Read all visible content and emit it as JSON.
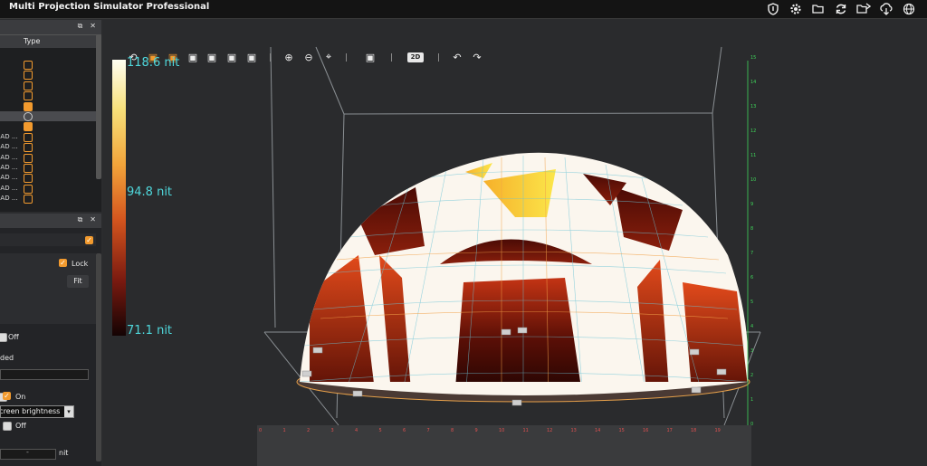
{
  "app": {
    "title": "Multi Projection Simulator Professional"
  },
  "titlebar_icons": [
    "shield-icon",
    "gear-icon",
    "folder-open-icon",
    "refresh-icon",
    "folder-load-icon",
    "cloud-download-icon",
    "globe-icon"
  ],
  "scene_panel": {
    "column_type": "Type",
    "items": [
      {
        "label": "",
        "icon": "box"
      },
      {
        "label": "",
        "icon": "box"
      },
      {
        "label": "",
        "icon": "house"
      },
      {
        "label": "",
        "icon": "sun"
      },
      {
        "label": "",
        "icon": "plus-filled"
      },
      {
        "label": "",
        "icon": "minus",
        "selected": true
      },
      {
        "label": "",
        "icon": "plus-filled"
      },
      {
        "label": "EAD ...",
        "icon": "projector"
      },
      {
        "label": "EAD ...",
        "icon": "projector"
      },
      {
        "label": "EAD ...",
        "icon": "projector"
      },
      {
        "label": "EAD ...",
        "icon": "projector"
      },
      {
        "label": "EAD ...",
        "icon": "projector"
      },
      {
        "label": "EAD ...",
        "icon": "projector"
      },
      {
        "label": "EAD ...",
        "icon": "projector"
      }
    ]
  },
  "props_panel": {
    "lock_label": "Lock",
    "fit_label": "Fit",
    "off_label_1": "Off",
    "ded_label": "ded",
    "on_label": "On",
    "mode_select": "screen brightness",
    "off_label_2": "Off",
    "value_placeholder": "-",
    "unit_label": "nit"
  },
  "viewport": {
    "mode_2d": "2D",
    "legend": {
      "max": "118.6 nit",
      "mid": "94.8 nit",
      "min": "71.1 nit"
    },
    "colors": {
      "accent": "#f29a2e",
      "legend_text": "#4fd8dc"
    },
    "x_ticks": [
      "0",
      "1",
      "2",
      "3",
      "4",
      "5",
      "6",
      "7",
      "8",
      "9",
      "10",
      "11",
      "12",
      "13",
      "14",
      "15",
      "16",
      "17",
      "18",
      "19"
    ],
    "y_ticks": [
      "0",
      "1",
      "2",
      "3",
      "4",
      "5",
      "6",
      "7",
      "8",
      "9",
      "10",
      "11",
      "12",
      "13",
      "14",
      "15"
    ]
  }
}
